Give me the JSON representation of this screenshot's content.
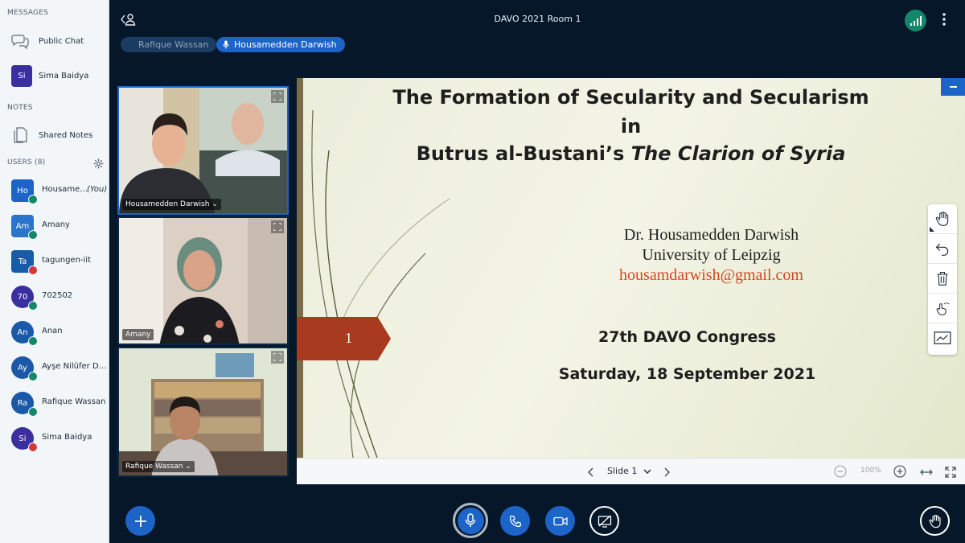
{
  "sidebar": {
    "messages_title": "MESSAGES",
    "public_chat": "Public Chat",
    "private_chat": {
      "initials": "Si",
      "name": "Sima Baidya",
      "color": "#3a2f9f"
    },
    "notes_title": "NOTES",
    "shared_notes": "Shared Notes",
    "users_title": "USERS (8)",
    "users": [
      {
        "initials": "Ho",
        "name": "Housame…",
        "you": "(You)",
        "color": "#1c64c8",
        "shape": "sq",
        "status": "#12876a"
      },
      {
        "initials": "Am",
        "name": "Amany",
        "you": "",
        "color": "#2a74cc",
        "shape": "sq",
        "status": "#12876a"
      },
      {
        "initials": "Ta",
        "name": "tagungen-iit",
        "you": "",
        "color": "#165cab",
        "shape": "sq",
        "status": "#d23a3a"
      },
      {
        "initials": "70",
        "name": "702502",
        "you": "",
        "color": "#3a2f9f",
        "shape": "round",
        "status": "#12876a"
      },
      {
        "initials": "An",
        "name": "Anan",
        "you": "",
        "color": "#1a58a8",
        "shape": "round",
        "status": "#12876a"
      },
      {
        "initials": "Ay",
        "name": "Ayşe Nilüfer D…",
        "you": "",
        "color": "#1a58a8",
        "shape": "round",
        "status": "#12876a"
      },
      {
        "initials": "Ra",
        "name": "Rafique Wassan",
        "you": "",
        "color": "#1a58a8",
        "shape": "round",
        "status": "#12876a"
      },
      {
        "initials": "Si",
        "name": "Sima Baidya",
        "you": "",
        "color": "#3a2f9f",
        "shape": "round",
        "status": "#d23a3a"
      }
    ]
  },
  "header": {
    "room_title": "DAVO 2021 Room 1",
    "talkers": [
      "Rafique Wassan",
      "Housamedden Darwish"
    ]
  },
  "webcams": [
    {
      "name": "Housamedden Darwish"
    },
    {
      "name": "Amany"
    },
    {
      "name": "Rafique Wassan"
    }
  ],
  "slide": {
    "title_line1": "The Formation of Secularity and Secularism",
    "title_line2": "in",
    "title_line3_plain": "Butrus al-Bustani’s ",
    "title_line3_italic": "The Clarion of Syria",
    "author": "Dr. Housamedden Darwish",
    "university": "University of Leipzig",
    "email": "housamdarwish@gmail.com",
    "slide_number": "1",
    "congress": "27th DAVO Congress",
    "date": "Saturday, 18 September 2021"
  },
  "slide_bar": {
    "current": "Slide 1",
    "zoom": "100%"
  },
  "colors": {
    "accent": "#1c64c8",
    "background": "#06172a",
    "talking": "#1c64c8",
    "arrow": "#a83a1f"
  }
}
